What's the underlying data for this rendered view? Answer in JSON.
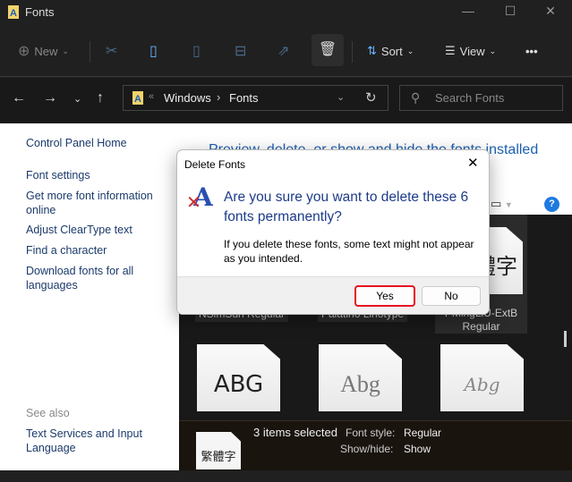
{
  "window": {
    "title": "Fonts"
  },
  "toolbar": {
    "new": "New",
    "sort": "Sort",
    "view": "View",
    "more": "•••"
  },
  "address": {
    "chevrons": "«",
    "path": [
      "Windows",
      "Fonts"
    ],
    "sep": "›",
    "search_placeholder": "Search Fonts"
  },
  "sidebar": {
    "home": "Control Panel Home",
    "items": [
      "Font settings",
      "Get more font information online",
      "Adjust ClearType text",
      "Find a character",
      "Download fonts for all languages"
    ],
    "see_also": "See also",
    "see_also_items": [
      "Text Services and Input Language"
    ]
  },
  "content": {
    "header": "Preview, delete, or show and hide the fonts installed"
  },
  "fonts": [
    {
      "name": "NSimSun Regular",
      "preview": ""
    },
    {
      "name": "Palatino Linotype",
      "preview": ""
    },
    {
      "name": "PMingLiU-ExtB Regular",
      "preview": "體字"
    },
    {
      "name": "",
      "preview": "ABG"
    },
    {
      "name": "",
      "preview": "Abg"
    },
    {
      "name": "",
      "preview": "Abg"
    }
  ],
  "details": {
    "preview": "繁體字",
    "selected": "3 items selected",
    "font_style_label": "Font style:",
    "font_style": "Regular",
    "showhide_label": "Show/hide:",
    "showhide": "Show"
  },
  "dialog": {
    "title": "Delete Fonts",
    "question": "Are you sure you want to delete these 6 fonts permanently?",
    "info": "If you delete these fonts, some text might not appear as you intended.",
    "yes": "Yes",
    "no": "No",
    "highlight_color": "#e81123"
  }
}
